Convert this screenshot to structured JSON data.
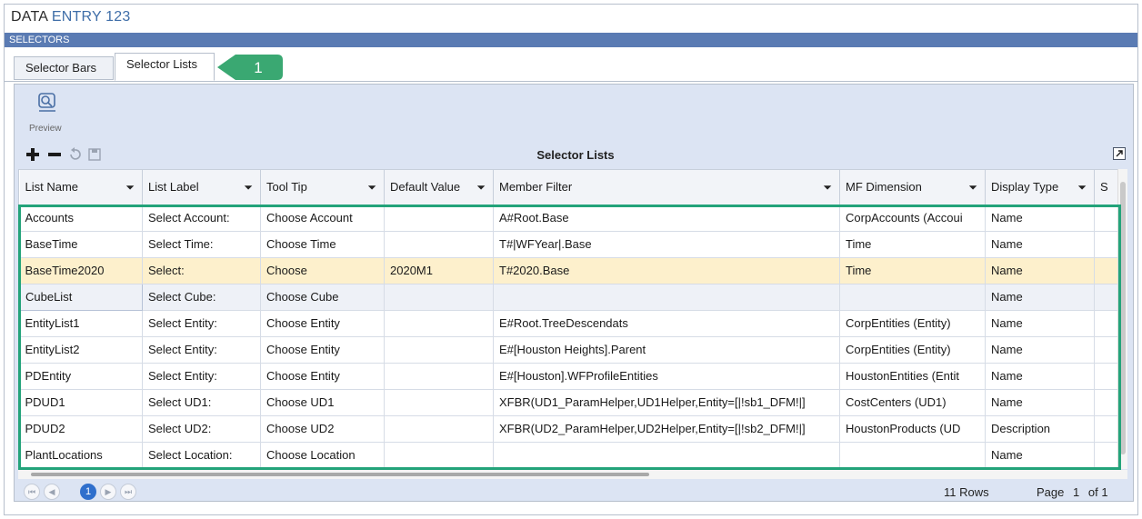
{
  "app": {
    "title_part1": "DATA",
    "title_part2": "ENTRY 123"
  },
  "section": {
    "label": "SELECTORS"
  },
  "tabs": [
    {
      "label": "Selector Bars",
      "active": false
    },
    {
      "label": "Selector Lists",
      "active": true
    }
  ],
  "callout": {
    "number": "1",
    "color": "#3aa872"
  },
  "toolbar": {
    "preview_label": "Preview"
  },
  "grid": {
    "title": "Selector Lists",
    "columns": [
      "List Name",
      "List Label",
      "Tool Tip",
      "Default Value",
      "Member Filter",
      "MF Dimension",
      "Display Type",
      "S"
    ],
    "rows": [
      [
        "Accounts",
        "Select Account:",
        "Choose Account",
        "",
        "A#Root.Base",
        "CorpAccounts  (Accoui",
        "Name"
      ],
      [
        "BaseTime",
        "Select Time:",
        "Choose Time",
        "",
        "T#|WFYear|.Base",
        "Time",
        "Name"
      ],
      [
        "BaseTime2020",
        "Select:",
        "Choose",
        "2020M1",
        "T#2020.Base",
        "Time",
        "Name"
      ],
      [
        "CubeList",
        "Select Cube:",
        "Choose Cube",
        "",
        "",
        "",
        "Name"
      ],
      [
        "EntityList1",
        "Select Entity:",
        "Choose Entity",
        "",
        "E#Root.TreeDescendats",
        "CorpEntities  (Entity)",
        "Name"
      ],
      [
        "EntityList2",
        "Select Entity:",
        "Choose Entity",
        "",
        "E#[Houston Heights].Parent",
        "CorpEntities  (Entity)",
        "Name"
      ],
      [
        "PDEntity",
        "Select Entity:",
        "Choose Entity",
        "",
        "E#[Houston].WFProfileEntities",
        "HoustonEntities  (Entit",
        "Name"
      ],
      [
        "PDUD1",
        "Select UD1:",
        "Choose UD1",
        "",
        "XFBR(UD1_ParamHelper,UD1Helper,Entity=[|!sb1_DFM!|]",
        "CostCenters  (UD1)",
        "Name"
      ],
      [
        "PDUD2",
        "Select UD2:",
        "Choose UD2",
        "",
        "XFBR(UD2_ParamHelper,UD2Helper,Entity=[|!sb2_DFM!|]",
        "HoustonProducts  (UD",
        "Description"
      ],
      [
        "PlantLocations",
        "Select Location:",
        "Choose Location",
        "",
        "",
        "",
        "Name"
      ]
    ],
    "selected_row": 2,
    "focused_row": 3
  },
  "pager": {
    "current_page": "1",
    "rows_text": "11 Rows",
    "page_text": "Page",
    "page_number": "1",
    "of_text": "of 1"
  },
  "colors": {
    "header_bar": "#5a7bb3",
    "highlight": "#23a37a",
    "selected_row": "#fdf0cc",
    "page_current": "#2f6fcc"
  }
}
